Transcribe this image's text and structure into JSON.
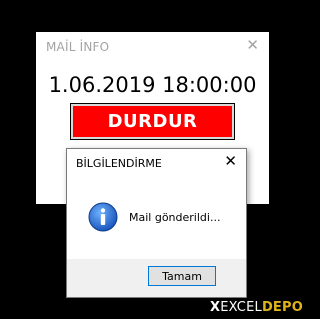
{
  "main_window": {
    "title": "MAİL İNFO",
    "close_glyph": "✕",
    "datetime": "1.06.2019 18:00:00",
    "stop_button": {
      "label": "DURDUR",
      "bg": "#ff0000",
      "fg": "#ffffff"
    }
  },
  "dialog": {
    "title": "BİLGİLENDİRME",
    "close_glyph": "✕",
    "icon": "info-icon",
    "message": "Mail gönderildi...",
    "ok_button": {
      "label": "Tamam"
    }
  },
  "watermark": {
    "x": "X",
    "excel": "EXCEL",
    "depo": "DEPO"
  },
  "colors": {
    "background": "#000000",
    "accent": "#0078d7",
    "watermark_accent": "#e0b31b"
  }
}
